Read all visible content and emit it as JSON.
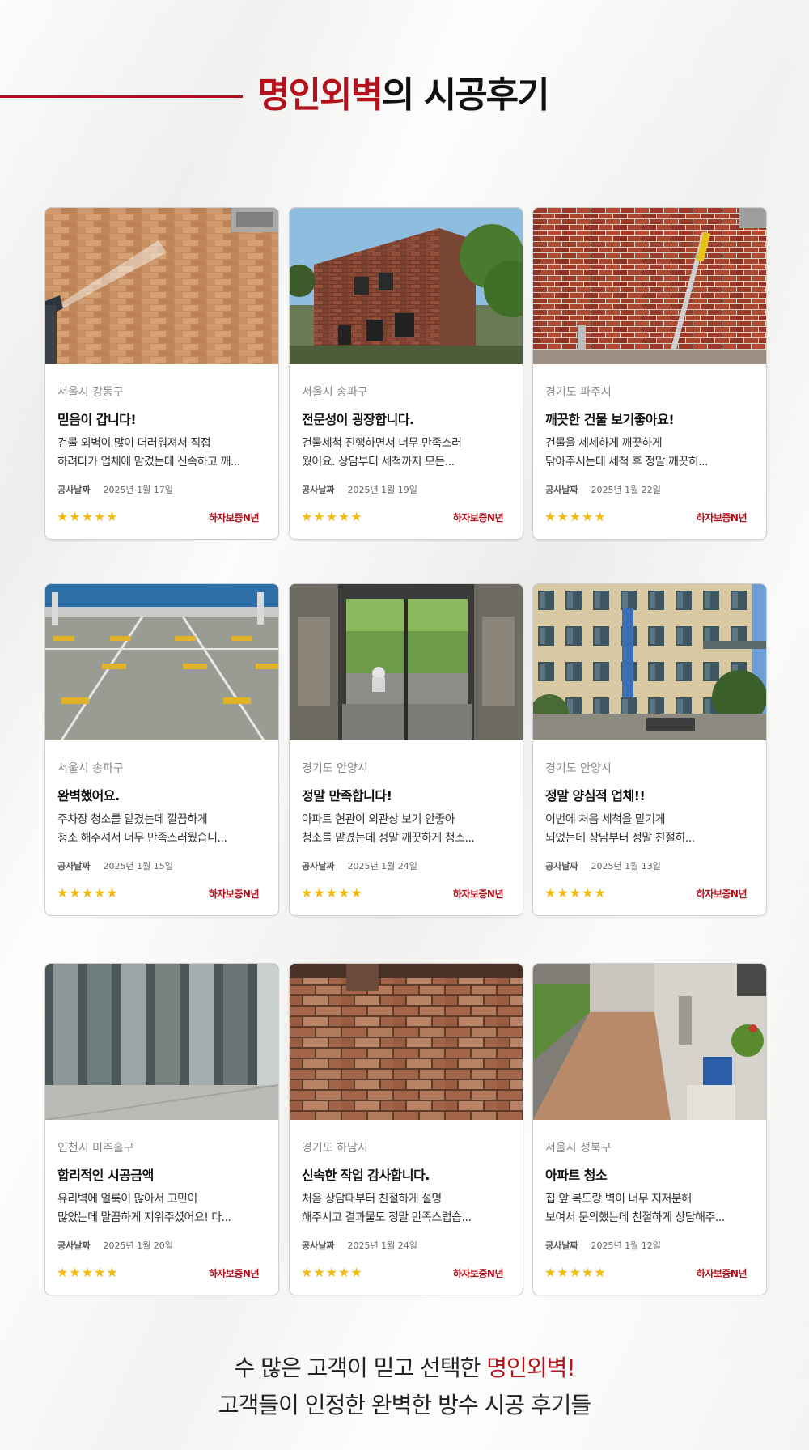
{
  "header": {
    "title_accent": "명인외벽",
    "title_rest": "의 시공후기"
  },
  "common": {
    "date_label": "공사날짜",
    "stars": "★★★★★",
    "warranty": "하자보증N년"
  },
  "reviews": [
    {
      "region": "서울시 강동구",
      "title": "믿음이 갑니다!",
      "body_line1": "건물 외벽이 많이 더러워져서 직접",
      "body_line2": "하려다가 업체에 맡겼는데 신속하고 깨...",
      "date": "2025년 1월 17일",
      "photo": "brick-power-wash"
    },
    {
      "region": "서울시 송파구",
      "title": "전문성이 굉장합니다.",
      "body_line1": "건물세척 진행하면서 너무 만족스러",
      "body_line2": "웠어요. 상담부터 세척까지 모든...",
      "date": "2025년 1월 19일",
      "photo": "brick-building-exterior"
    },
    {
      "region": "경기도 파주시",
      "title": "깨끗한 건물 보기좋아요!",
      "body_line1": "건물을 세세하게 깨끗하게",
      "body_line2": "닦아주시는데 세척 후 정말 깨끗히...",
      "date": "2025년 1월 22일",
      "photo": "brick-wall-cleaning-pole"
    },
    {
      "region": "서울시 송파구",
      "title": "완벽했어요.",
      "body_line1": "주차장 청소를 맡겼는데 깔끔하게",
      "body_line2": "청소 해주셔서 너무 만족스러웠습니...",
      "date": "2025년 1월 15일",
      "photo": "parking-garage"
    },
    {
      "region": "경기도 안양시",
      "title": "정말 만족합니다!",
      "body_line1": "아파트 현관이 외관상 보기 안좋아",
      "body_line2": "청소를 맡겼는데 정말 깨끗하게 청소...",
      "date": "2025년 1월 24일",
      "photo": "apartment-entrance"
    },
    {
      "region": "경기도 안양시",
      "title": "정말 양심적 업체!!",
      "body_line1": "이번에 처음 세척을 맡기게",
      "body_line2": "되었는데 상담부터 정말 친절히...",
      "date": "2025년 1월 13일",
      "photo": "institutional-building"
    },
    {
      "region": "인천시 미추홀구",
      "title": "합리적인 시공금액",
      "body_line1": "유리벽에 얼룩이 많아서 고민이",
      "body_line2": "많았는데 말끔하게 지워주셨어요! 다...",
      "date": "2025년 1월 20일",
      "photo": "glass-facade"
    },
    {
      "region": "경기도 하남시",
      "title": "신속한 작업 감사합니다.",
      "body_line1": "처음 상담때부터 친절하게 설명",
      "body_line2": "해주시고 결과물도 정말 만족스럽습...",
      "date": "2025년 1월 24일",
      "photo": "old-brick-wall"
    },
    {
      "region": "서울시 성북구",
      "title": "아파트 청소",
      "body_line1": "집 앞 복도랑 벽이 너무 지저분해",
      "body_line2": "보여서 문의했는데 친절하게 상담해주...",
      "date": "2025년 1월 12일",
      "photo": "apartment-corridor"
    }
  ],
  "footer": {
    "line1_before": "수 많은 고객이 믿고 선택한 ",
    "line1_accent": "명인외벽!",
    "line2": "고객들이 인정한 완벽한 방수 시공 후기들"
  }
}
